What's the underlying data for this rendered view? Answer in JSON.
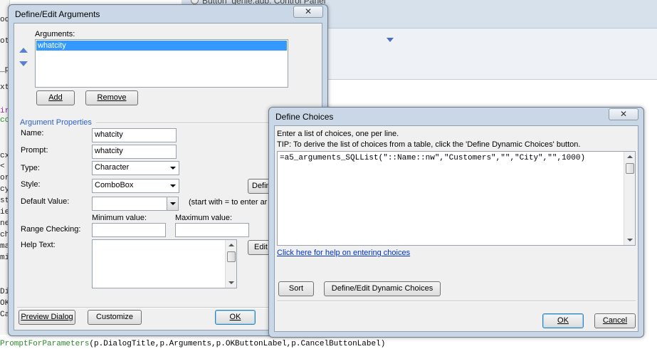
{
  "background": {
    "window_title": "Button_genie.adb: Control Panel",
    "bottom_code_keyword": "PromptForParameters",
    "bottom_code_rest": "(p.DialogTitle,p.Arguments,p.OKButtonLabel,p.CancelButtonLabel)",
    "left_fragments": [
      "oo",
      "ots",
      "_p",
      "xt",
      "ir",
      "cc",
      "cx",
      "<",
      "or",
      "cy",
      "st",
      "ie",
      "ne",
      "ch",
      "ma",
      "mi",
      "Di",
      "OK",
      "Ca"
    ]
  },
  "define_args": {
    "title": "Define/Edit Arguments",
    "close_label": "✕",
    "arguments_label": "Arguments:",
    "arguments_list": [
      "whatcity"
    ],
    "add_button": "Add",
    "remove_button": "Remove",
    "properties_heading": "Argument Properties",
    "name_label": "Name:",
    "name_value": "whatcity",
    "prompt_label": "Prompt:",
    "prompt_value": "whatcity",
    "type_label": "Type:",
    "type_value": "Character",
    "style_label": "Style:",
    "style_value": "ComboBox",
    "define_button_partial": "Defin",
    "default_label": "Default Value:",
    "default_value": "",
    "default_hint": "(start with = to enter ar",
    "min_label": "Minimum value:",
    "max_label": "Maximum value:",
    "range_label": "Range Checking:",
    "min_value": "",
    "max_value": "",
    "help_label": "Help Text:",
    "help_value": "",
    "edit_button_partial": "Edit",
    "preview_button": "Preview Dialog",
    "customize_button": "Customize",
    "ok_button": "OK"
  },
  "define_choices": {
    "title": "Define Choices",
    "close_label": "✕",
    "instruction": "Enter a list of choices, one per line.",
    "tip": "TIP: To derive the list of choices from a table, click the 'Define Dynamic Choices' button.",
    "choices_text": "=a5_arguments_SQLList(\"::Name::nw\",\"Customers\",\"\",\"City\",\"\",1000)",
    "help_link": "Click here for help on entering choices",
    "sort_button": "Sort",
    "dynamic_button": "Define/Edit Dynamic Choices",
    "ok_button": "OK",
    "cancel_button": "Cancel"
  },
  "colors": {
    "selection": "#3399ff",
    "heading_blue": "#2b5fcc",
    "link_blue": "#0033cc",
    "frame": "#c9d7e6"
  }
}
